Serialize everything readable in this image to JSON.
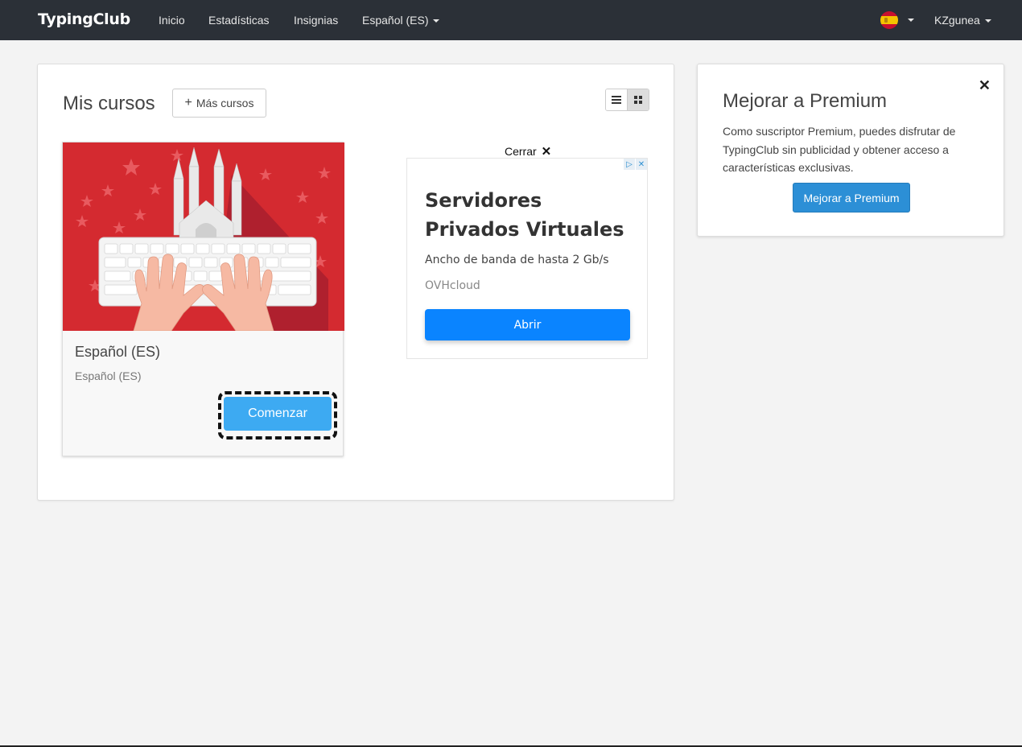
{
  "nav": {
    "brand": "TypingClub",
    "links": [
      "Inicio",
      "Estadísticas",
      "Insignias"
    ],
    "language": "Español (ES)",
    "user": "KZgunea"
  },
  "courses": {
    "title": "Mis cursos",
    "more_button": "Más cursos",
    "card": {
      "title": "Español (ES)",
      "subtitle": "Español (ES)",
      "start_button": "Comenzar"
    }
  },
  "ad": {
    "close_label": "Cerrar",
    "headline": "Servidores Privados Virtuales",
    "body": "Ancho de banda de hasta 2 Gb/s",
    "source": "OVHcloud",
    "button": "Abrir"
  },
  "premium": {
    "title": "Mejorar a Premium",
    "text": "Como suscriptor Premium, puedes disfrutar de TypingClub sin publicidad y obtener acceso a características exclusivas.",
    "button": "Mejorar a Premium"
  },
  "colors": {
    "navbar": "#2b3037",
    "card_image_red": "#d42a30",
    "start_button": "#3daaf2",
    "ad_button": "#0a84ff",
    "premium_button": "#2c8fd6"
  }
}
